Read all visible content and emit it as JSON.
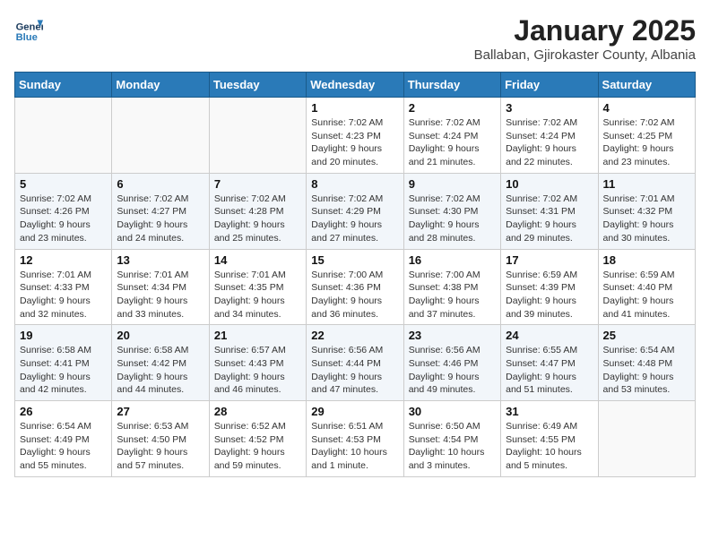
{
  "header": {
    "logo_line1": "General",
    "logo_line2": "Blue",
    "month": "January 2025",
    "location": "Ballaban, Gjirokaster County, Albania"
  },
  "weekdays": [
    "Sunday",
    "Monday",
    "Tuesday",
    "Wednesday",
    "Thursday",
    "Friday",
    "Saturday"
  ],
  "weeks": [
    [
      {
        "day": "",
        "detail": ""
      },
      {
        "day": "",
        "detail": ""
      },
      {
        "day": "",
        "detail": ""
      },
      {
        "day": "1",
        "detail": "Sunrise: 7:02 AM\nSunset: 4:23 PM\nDaylight: 9 hours\nand 20 minutes."
      },
      {
        "day": "2",
        "detail": "Sunrise: 7:02 AM\nSunset: 4:24 PM\nDaylight: 9 hours\nand 21 minutes."
      },
      {
        "day": "3",
        "detail": "Sunrise: 7:02 AM\nSunset: 4:24 PM\nDaylight: 9 hours\nand 22 minutes."
      },
      {
        "day": "4",
        "detail": "Sunrise: 7:02 AM\nSunset: 4:25 PM\nDaylight: 9 hours\nand 23 minutes."
      }
    ],
    [
      {
        "day": "5",
        "detail": "Sunrise: 7:02 AM\nSunset: 4:26 PM\nDaylight: 9 hours\nand 23 minutes."
      },
      {
        "day": "6",
        "detail": "Sunrise: 7:02 AM\nSunset: 4:27 PM\nDaylight: 9 hours\nand 24 minutes."
      },
      {
        "day": "7",
        "detail": "Sunrise: 7:02 AM\nSunset: 4:28 PM\nDaylight: 9 hours\nand 25 minutes."
      },
      {
        "day": "8",
        "detail": "Sunrise: 7:02 AM\nSunset: 4:29 PM\nDaylight: 9 hours\nand 27 minutes."
      },
      {
        "day": "9",
        "detail": "Sunrise: 7:02 AM\nSunset: 4:30 PM\nDaylight: 9 hours\nand 28 minutes."
      },
      {
        "day": "10",
        "detail": "Sunrise: 7:02 AM\nSunset: 4:31 PM\nDaylight: 9 hours\nand 29 minutes."
      },
      {
        "day": "11",
        "detail": "Sunrise: 7:01 AM\nSunset: 4:32 PM\nDaylight: 9 hours\nand 30 minutes."
      }
    ],
    [
      {
        "day": "12",
        "detail": "Sunrise: 7:01 AM\nSunset: 4:33 PM\nDaylight: 9 hours\nand 32 minutes."
      },
      {
        "day": "13",
        "detail": "Sunrise: 7:01 AM\nSunset: 4:34 PM\nDaylight: 9 hours\nand 33 minutes."
      },
      {
        "day": "14",
        "detail": "Sunrise: 7:01 AM\nSunset: 4:35 PM\nDaylight: 9 hours\nand 34 minutes."
      },
      {
        "day": "15",
        "detail": "Sunrise: 7:00 AM\nSunset: 4:36 PM\nDaylight: 9 hours\nand 36 minutes."
      },
      {
        "day": "16",
        "detail": "Sunrise: 7:00 AM\nSunset: 4:38 PM\nDaylight: 9 hours\nand 37 minutes."
      },
      {
        "day": "17",
        "detail": "Sunrise: 6:59 AM\nSunset: 4:39 PM\nDaylight: 9 hours\nand 39 minutes."
      },
      {
        "day": "18",
        "detail": "Sunrise: 6:59 AM\nSunset: 4:40 PM\nDaylight: 9 hours\nand 41 minutes."
      }
    ],
    [
      {
        "day": "19",
        "detail": "Sunrise: 6:58 AM\nSunset: 4:41 PM\nDaylight: 9 hours\nand 42 minutes."
      },
      {
        "day": "20",
        "detail": "Sunrise: 6:58 AM\nSunset: 4:42 PM\nDaylight: 9 hours\nand 44 minutes."
      },
      {
        "day": "21",
        "detail": "Sunrise: 6:57 AM\nSunset: 4:43 PM\nDaylight: 9 hours\nand 46 minutes."
      },
      {
        "day": "22",
        "detail": "Sunrise: 6:56 AM\nSunset: 4:44 PM\nDaylight: 9 hours\nand 47 minutes."
      },
      {
        "day": "23",
        "detail": "Sunrise: 6:56 AM\nSunset: 4:46 PM\nDaylight: 9 hours\nand 49 minutes."
      },
      {
        "day": "24",
        "detail": "Sunrise: 6:55 AM\nSunset: 4:47 PM\nDaylight: 9 hours\nand 51 minutes."
      },
      {
        "day": "25",
        "detail": "Sunrise: 6:54 AM\nSunset: 4:48 PM\nDaylight: 9 hours\nand 53 minutes."
      }
    ],
    [
      {
        "day": "26",
        "detail": "Sunrise: 6:54 AM\nSunset: 4:49 PM\nDaylight: 9 hours\nand 55 minutes."
      },
      {
        "day": "27",
        "detail": "Sunrise: 6:53 AM\nSunset: 4:50 PM\nDaylight: 9 hours\nand 57 minutes."
      },
      {
        "day": "28",
        "detail": "Sunrise: 6:52 AM\nSunset: 4:52 PM\nDaylight: 9 hours\nand 59 minutes."
      },
      {
        "day": "29",
        "detail": "Sunrise: 6:51 AM\nSunset: 4:53 PM\nDaylight: 10 hours\nand 1 minute."
      },
      {
        "day": "30",
        "detail": "Sunrise: 6:50 AM\nSunset: 4:54 PM\nDaylight: 10 hours\nand 3 minutes."
      },
      {
        "day": "31",
        "detail": "Sunrise: 6:49 AM\nSunset: 4:55 PM\nDaylight: 10 hours\nand 5 minutes."
      },
      {
        "day": "",
        "detail": ""
      }
    ]
  ]
}
